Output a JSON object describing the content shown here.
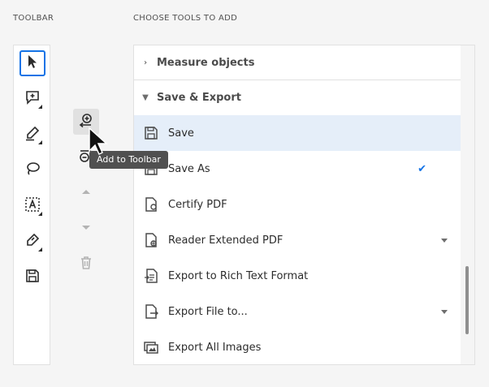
{
  "labels": {
    "toolbar": "TOOLBAR",
    "choose_tools": "CHOOSE TOOLS TO ADD"
  },
  "toolbar_tools": [
    {
      "icon": "select-arrow-icon",
      "selected": true
    },
    {
      "icon": "comment-add-icon"
    },
    {
      "icon": "highlighter-icon"
    },
    {
      "icon": "lasso-icon"
    },
    {
      "icon": "text-recognition-icon"
    },
    {
      "icon": "sign-pen-icon"
    },
    {
      "icon": "save-icon"
    }
  ],
  "mid_controls": {
    "add_icon": "add-to-toolbar-icon",
    "remove_icon": "remove-from-toolbar-icon",
    "up_icon": "move-up-icon",
    "down_icon": "move-down-icon",
    "delete_icon": "trash-icon"
  },
  "tooltip": "Add to Toolbar",
  "groups": {
    "measure": {
      "label": "Measure objects",
      "expanded": false
    },
    "save_export": {
      "label": "Save & Export",
      "expanded": true
    }
  },
  "items": [
    {
      "label": "Save",
      "icon": "save-icon",
      "selected": true
    },
    {
      "label": "Save As",
      "icon": "save-as-icon",
      "checked": true,
      "check_mark": "✔"
    },
    {
      "label": "Certify PDF",
      "icon": "certify-icon"
    },
    {
      "label": "Reader Extended PDF",
      "icon": "reader-extended-icon",
      "dropdown": true
    },
    {
      "label": "Export to Rich Text Format",
      "icon": "export-rtf-icon"
    },
    {
      "label": "Export File to...",
      "icon": "export-file-icon",
      "dropdown": true
    },
    {
      "label": "Export All Images",
      "icon": "export-images-icon"
    }
  ],
  "colors": {
    "accent": "#1473e6",
    "selected_row": "#e5eef9",
    "tooltip_bg": "#505050"
  }
}
